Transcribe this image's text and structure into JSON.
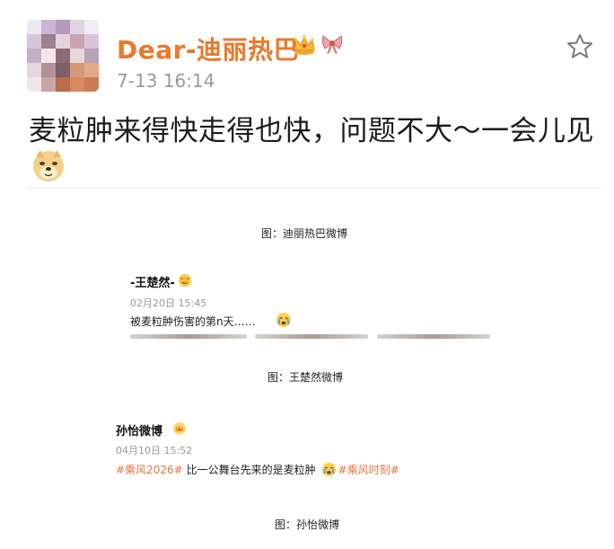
{
  "post1": {
    "author": "Dear-迪丽热巴",
    "time": "7-13 16:14",
    "text": "麦粒肿来得快走得也快，问题不大～一会儿见",
    "icons": [
      "crown-icon",
      "bow-icon",
      "star-icon",
      "doge-emoji-icon"
    ],
    "caption": "图：迪丽热巴微博"
  },
  "post2": {
    "author": "-王楚然-",
    "time": "02月20日 15:45",
    "text": "被麦粒肿伤害的第n天……",
    "icons": [
      "heart-eyes-badge-icon",
      "crying-emoji-icon"
    ],
    "caption": "图：王楚然微博"
  },
  "post3": {
    "author": "孙怡微博",
    "time": "04月10日 15:52",
    "tag1": "#乘风2026#",
    "text": "比一公舞台先来的是麦粒肿",
    "tag2": "#乘风时刻#",
    "icons": [
      "crown-badge-icon",
      "crying-emoji-icon"
    ],
    "caption": "图：孙怡微博"
  },
  "colors": {
    "username_orange": "#e97a2c",
    "topic_orange": "#eb7340",
    "time_gray": "#9a9a9a"
  }
}
